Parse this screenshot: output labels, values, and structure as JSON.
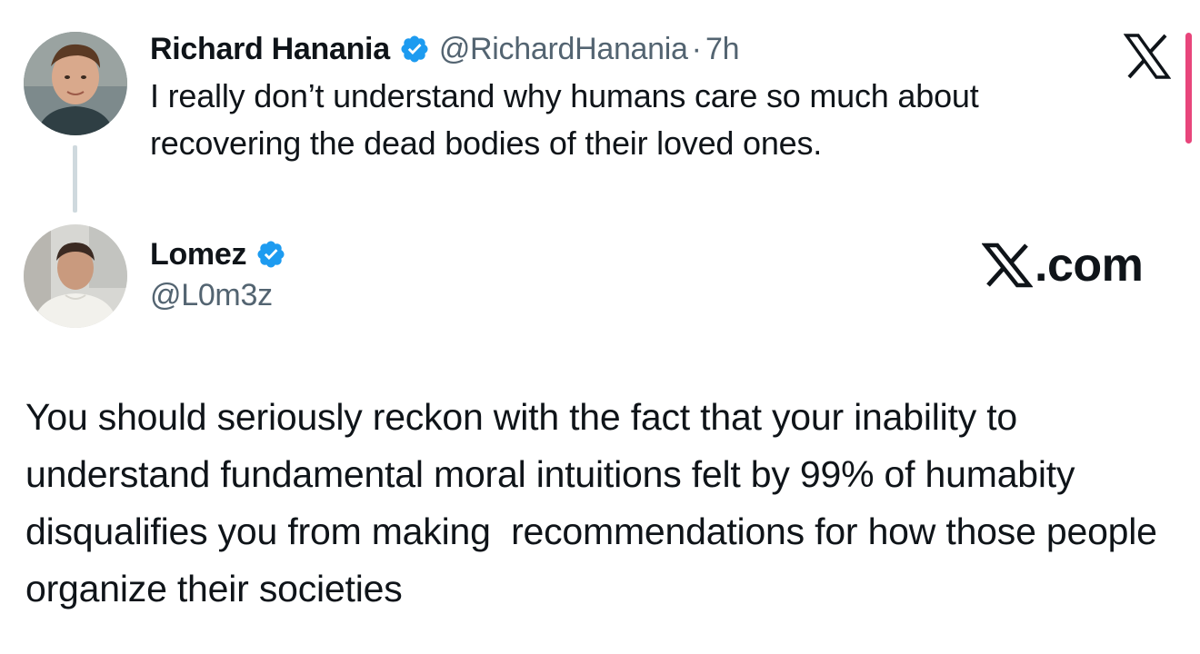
{
  "tweet_original": {
    "display_name": "Richard Hanania",
    "handle": "@RichardHanania",
    "separator": "·",
    "time": "7h",
    "text": "I really don’t understand why humans care so much about recovering the dead bodies of their loved ones.",
    "verified": true
  },
  "tweet_reply": {
    "display_name": "Lomez",
    "handle": "@L0m3z",
    "text": "You should seriously reckon with the fact that your inability to understand fundamental moral intuitions felt by 99% of humabity disqualifies you from making  recommendations for how those people organize their societies",
    "verified": true
  },
  "branding": {
    "watermark_text": ".com",
    "corner_icon": "x-logo-icon",
    "verified_icon": "verified-badge-icon"
  },
  "colors": {
    "text_primary": "#0f1419",
    "text_secondary": "#536471",
    "verified_blue": "#1d9bf0",
    "thread_line": "#cfd9de",
    "accent_pink": "#e8457b"
  }
}
